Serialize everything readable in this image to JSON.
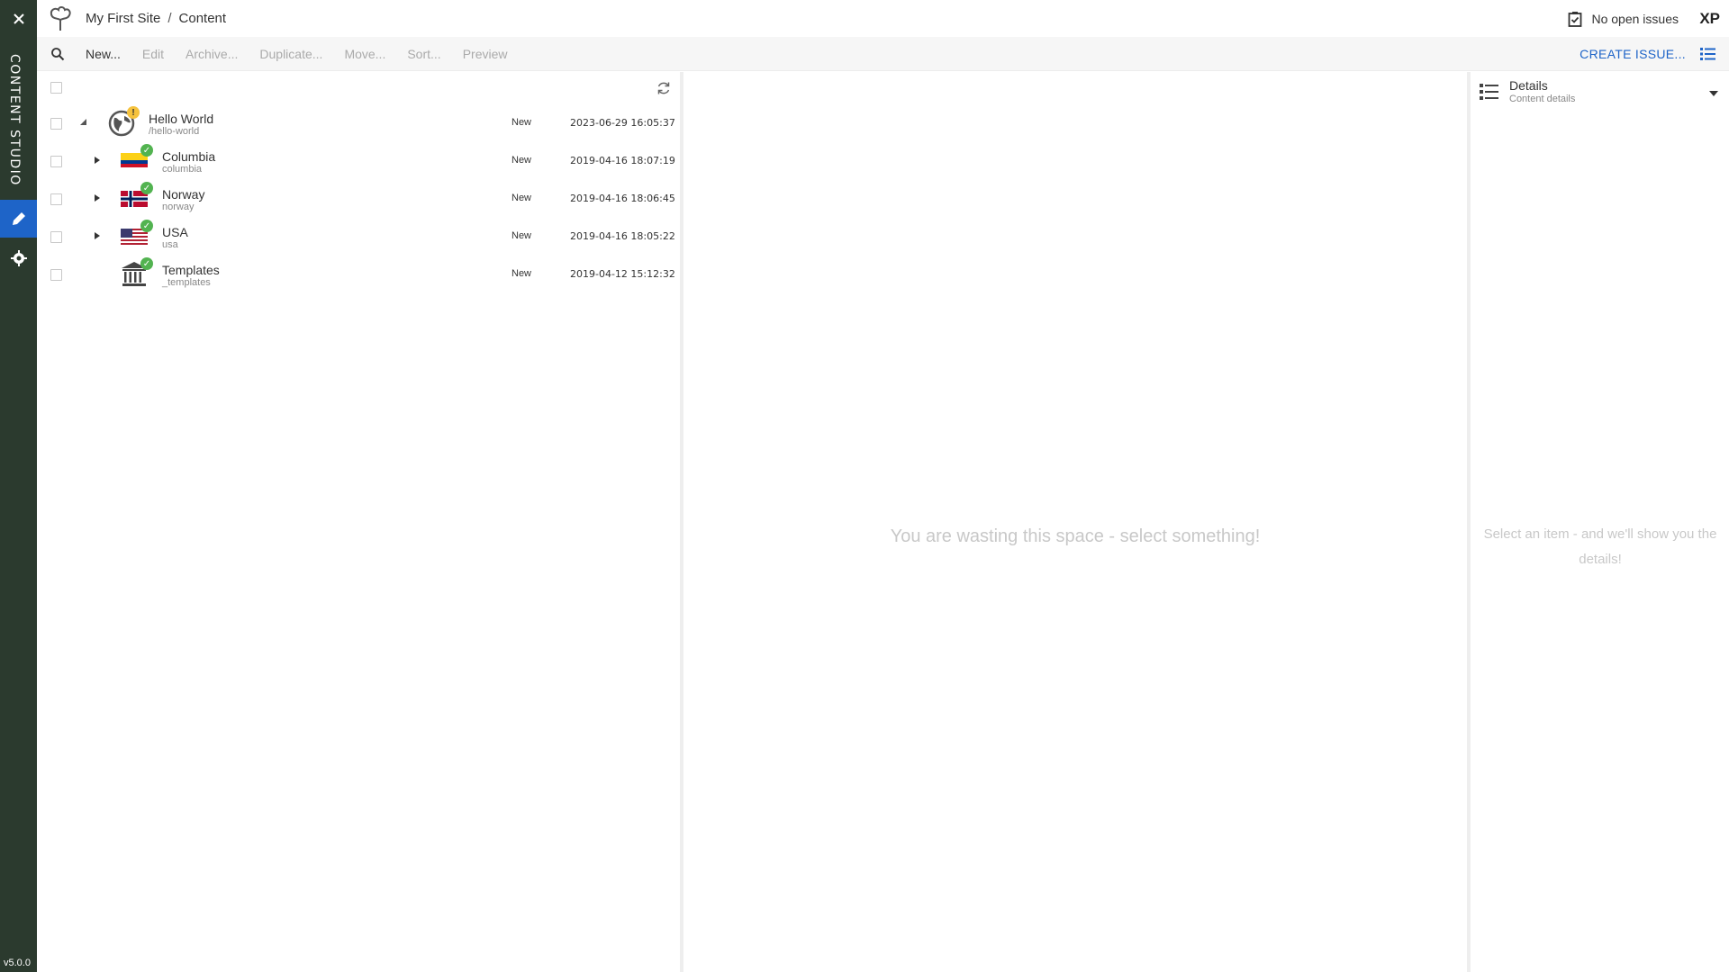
{
  "app": {
    "name": "CONTENT STUDIO",
    "version": "v5.0.0"
  },
  "topbar": {
    "site": "My First Site",
    "separator": "/",
    "section": "Content",
    "issues": "No open issues",
    "xp_logo": "XP"
  },
  "toolbar": {
    "items": [
      {
        "label": "New...",
        "enabled": true
      },
      {
        "label": "Edit",
        "enabled": false
      },
      {
        "label": "Archive...",
        "enabled": false
      },
      {
        "label": "Duplicate...",
        "enabled": false
      },
      {
        "label": "Move...",
        "enabled": false
      },
      {
        "label": "Sort...",
        "enabled": false
      },
      {
        "label": "Preview",
        "enabled": false
      }
    ],
    "create_issue": "CREATE ISSUE..."
  },
  "grid": {
    "rows": [
      {
        "name": "Hello World",
        "path": "/hello-world",
        "status": "New",
        "modified": "2023-06-29 16:05:37",
        "icon": "globe-icon",
        "badge": "warning",
        "expander": "expanded"
      },
      {
        "name": "Columbia",
        "path": "columbia",
        "status": "New",
        "modified": "2019-04-16 18:07:19",
        "icon": "colombia-flag-icon",
        "badge": "ok",
        "expander": "collapsed"
      },
      {
        "name": "Norway",
        "path": "norway",
        "status": "New",
        "modified": "2019-04-16 18:06:45",
        "icon": "norway-flag-icon",
        "badge": "ok",
        "expander": "collapsed"
      },
      {
        "name": "USA",
        "path": "usa",
        "status": "New",
        "modified": "2019-04-16 18:05:22",
        "icon": "usa-flag-icon",
        "badge": "ok",
        "expander": "collapsed"
      },
      {
        "name": "Templates",
        "path": "_templates",
        "status": "New",
        "modified": "2019-04-12 15:12:32",
        "icon": "templates-icon",
        "badge": "ok",
        "expander": "none"
      }
    ]
  },
  "preview": {
    "empty_message": "You are wasting this space - select something!"
  },
  "details": {
    "title": "Details",
    "subtitle": "Content details",
    "empty_message": "Select an item - and we'll show you the details!"
  },
  "colors": {
    "sidebar_bg": "#2b3a2e",
    "accent": "#1e64c8",
    "ok_badge": "#52b350",
    "warn_badge": "#f5c23d"
  }
}
